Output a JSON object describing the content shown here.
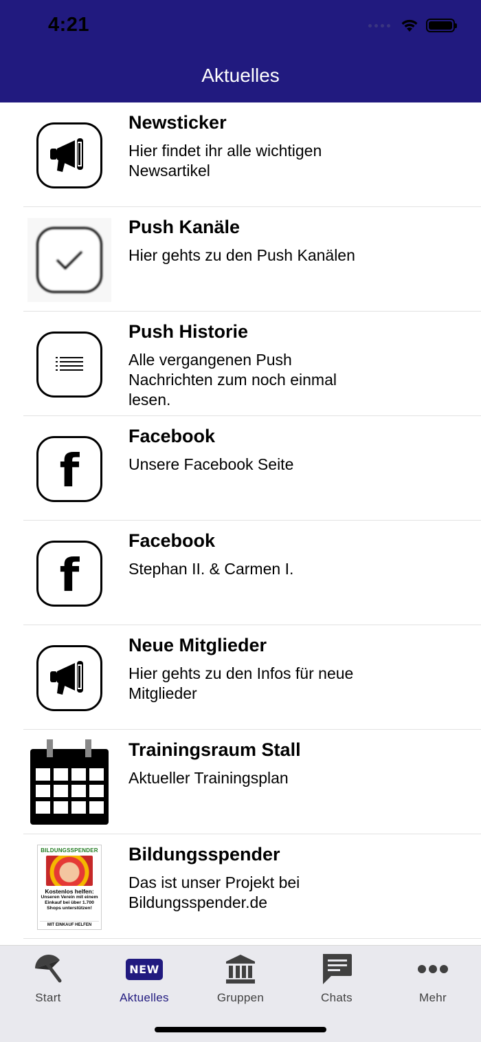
{
  "status_bar": {
    "time": "4:21"
  },
  "header": {
    "title": "Aktuelles"
  },
  "items": [
    {
      "title": "Newsticker",
      "subtitle": "Hier findet ihr alle wichtigen Newsartikel",
      "icon": "megaphone-icon"
    },
    {
      "title": "Push Kanäle",
      "subtitle": "Hier gehts zu den Push Kanälen",
      "icon": "checkmark-icon"
    },
    {
      "title": "Push Historie",
      "subtitle": "Alle vergangenen Push Nachrichten zum noch einmal lesen.",
      "icon": "list-icon"
    },
    {
      "title": "Facebook",
      "subtitle": "Unsere Facebook Seite",
      "icon": "facebook-icon"
    },
    {
      "title": "Facebook",
      "subtitle": "Stephan II. & Carmen I.",
      "icon": "facebook-icon"
    },
    {
      "title": "Neue Mitglieder",
      "subtitle": "Hier gehts zu den Infos für neue Mitglieder",
      "icon": "megaphone-icon"
    },
    {
      "title": "Trainingsraum Stall",
      "subtitle": "Aktueller Trainingsplan",
      "icon": "calendar-icon"
    },
    {
      "title": "Bildungsspender",
      "subtitle": "Das ist unser Projekt bei Bildungsspender.de",
      "icon": "bildungsspender-thumbnail",
      "thumbnail": {
        "heading": "BILDUNGSSPENDER",
        "bold": "Kostenlos helfen:",
        "text": "Unseren Verein mit einem Einkauf bei über 1.700 Shops unterstützen!",
        "footer": "MIT EINKAUF HELFEN"
      }
    }
  ],
  "tabbar": {
    "active_color": "#211a7f",
    "tabs": [
      {
        "label": "Start",
        "icon": "umbrella-icon"
      },
      {
        "label": "Aktuelles",
        "icon": "new-badge-icon",
        "badge": "NEW",
        "active": true
      },
      {
        "label": "Gruppen",
        "icon": "institution-icon"
      },
      {
        "label": "Chats",
        "icon": "chat-icon"
      },
      {
        "label": "Mehr",
        "icon": "more-icon"
      }
    ]
  },
  "colors": {
    "header_bg": "#211a7f",
    "tabbar_bg": "#e9e9ee"
  }
}
